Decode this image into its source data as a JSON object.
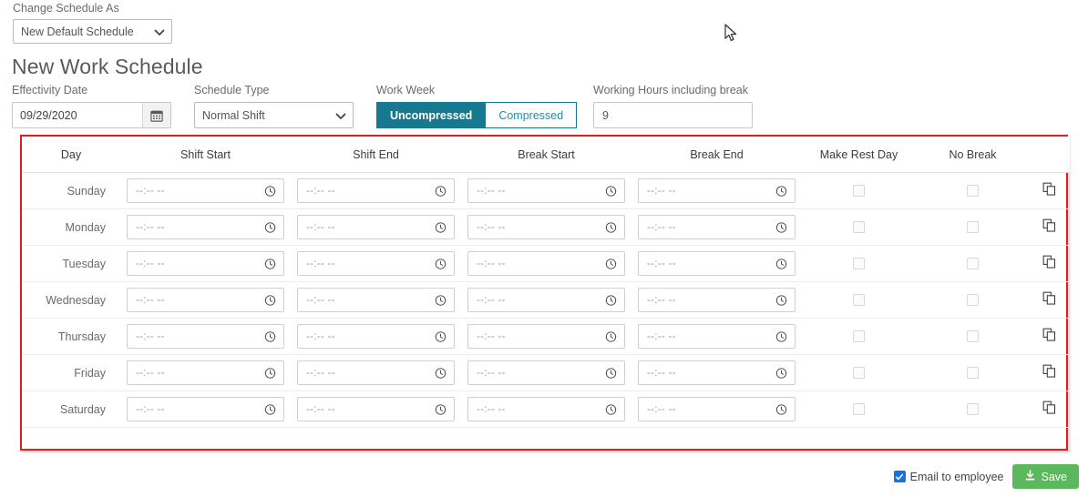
{
  "top": {
    "change_schedule_label": "Change Schedule As",
    "change_schedule_value": "New Default Schedule",
    "change_schedule_options": [
      "New Default Schedule"
    ]
  },
  "page_title": "New Work Schedule",
  "filters": {
    "effectivity_date": {
      "label": "Effectivity Date",
      "value": "09/29/2020",
      "placeholder": "mm/dd/yyyy",
      "icon": "calendar-icon"
    },
    "schedule_type": {
      "label": "Schedule Type",
      "value": "Normal Shift",
      "options": [
        "Normal Shift"
      ]
    },
    "work_week": {
      "label": "Work Week",
      "selected": "Uncompressed",
      "options": [
        "Uncompressed",
        "Compressed"
      ]
    },
    "working_hours": {
      "label": "Working Hours including break",
      "value": "9",
      "placeholder": ""
    }
  },
  "schedule_table": {
    "headers": [
      "Day",
      "Shift Start",
      "Shift End",
      "Break Start",
      "Break End",
      "Make Rest Day",
      "No Break",
      ""
    ],
    "time_placeholder": "--:-- --",
    "rows": [
      {
        "day": "Sunday",
        "shift_start": "",
        "shift_end": "",
        "break_start": "",
        "break_end": "",
        "make_rest_day": false,
        "no_break": false,
        "copy_icon": "copy-icon"
      },
      {
        "day": "Monday",
        "shift_start": "",
        "shift_end": "",
        "break_start": "",
        "break_end": "",
        "make_rest_day": false,
        "no_break": false,
        "copy_icon": "copy-icon"
      },
      {
        "day": "Tuesday",
        "shift_start": "",
        "shift_end": "",
        "break_start": "",
        "break_end": "",
        "make_rest_day": false,
        "no_break": false,
        "copy_icon": "copy-icon"
      },
      {
        "day": "Wednesday",
        "shift_start": "",
        "shift_end": "",
        "break_start": "",
        "break_end": "",
        "make_rest_day": false,
        "no_break": false,
        "copy_icon": "copy-icon"
      },
      {
        "day": "Thursday",
        "shift_start": "",
        "shift_end": "",
        "break_start": "",
        "break_end": "",
        "make_rest_day": false,
        "no_break": false,
        "copy_icon": "copy-icon"
      },
      {
        "day": "Friday",
        "shift_start": "",
        "shift_end": "",
        "break_start": "",
        "break_end": "",
        "make_rest_day": false,
        "no_break": false,
        "copy_icon": "copy-icon"
      },
      {
        "day": "Saturday",
        "shift_start": "",
        "shift_end": "",
        "break_start": "",
        "break_end": "",
        "make_rest_day": false,
        "no_break": false,
        "copy_icon": "copy-icon"
      }
    ]
  },
  "footer": {
    "email_label": "Email to employee",
    "email_checked": true,
    "save_label": "Save",
    "save_icon": "download-icon"
  },
  "colors": {
    "accent_teal": "#17798f",
    "accent_teal_text": "#2b8ca3",
    "highlight_red": "#e81b1b",
    "save_green": "#5cb85c",
    "checkbox_blue": "#1473e6"
  }
}
